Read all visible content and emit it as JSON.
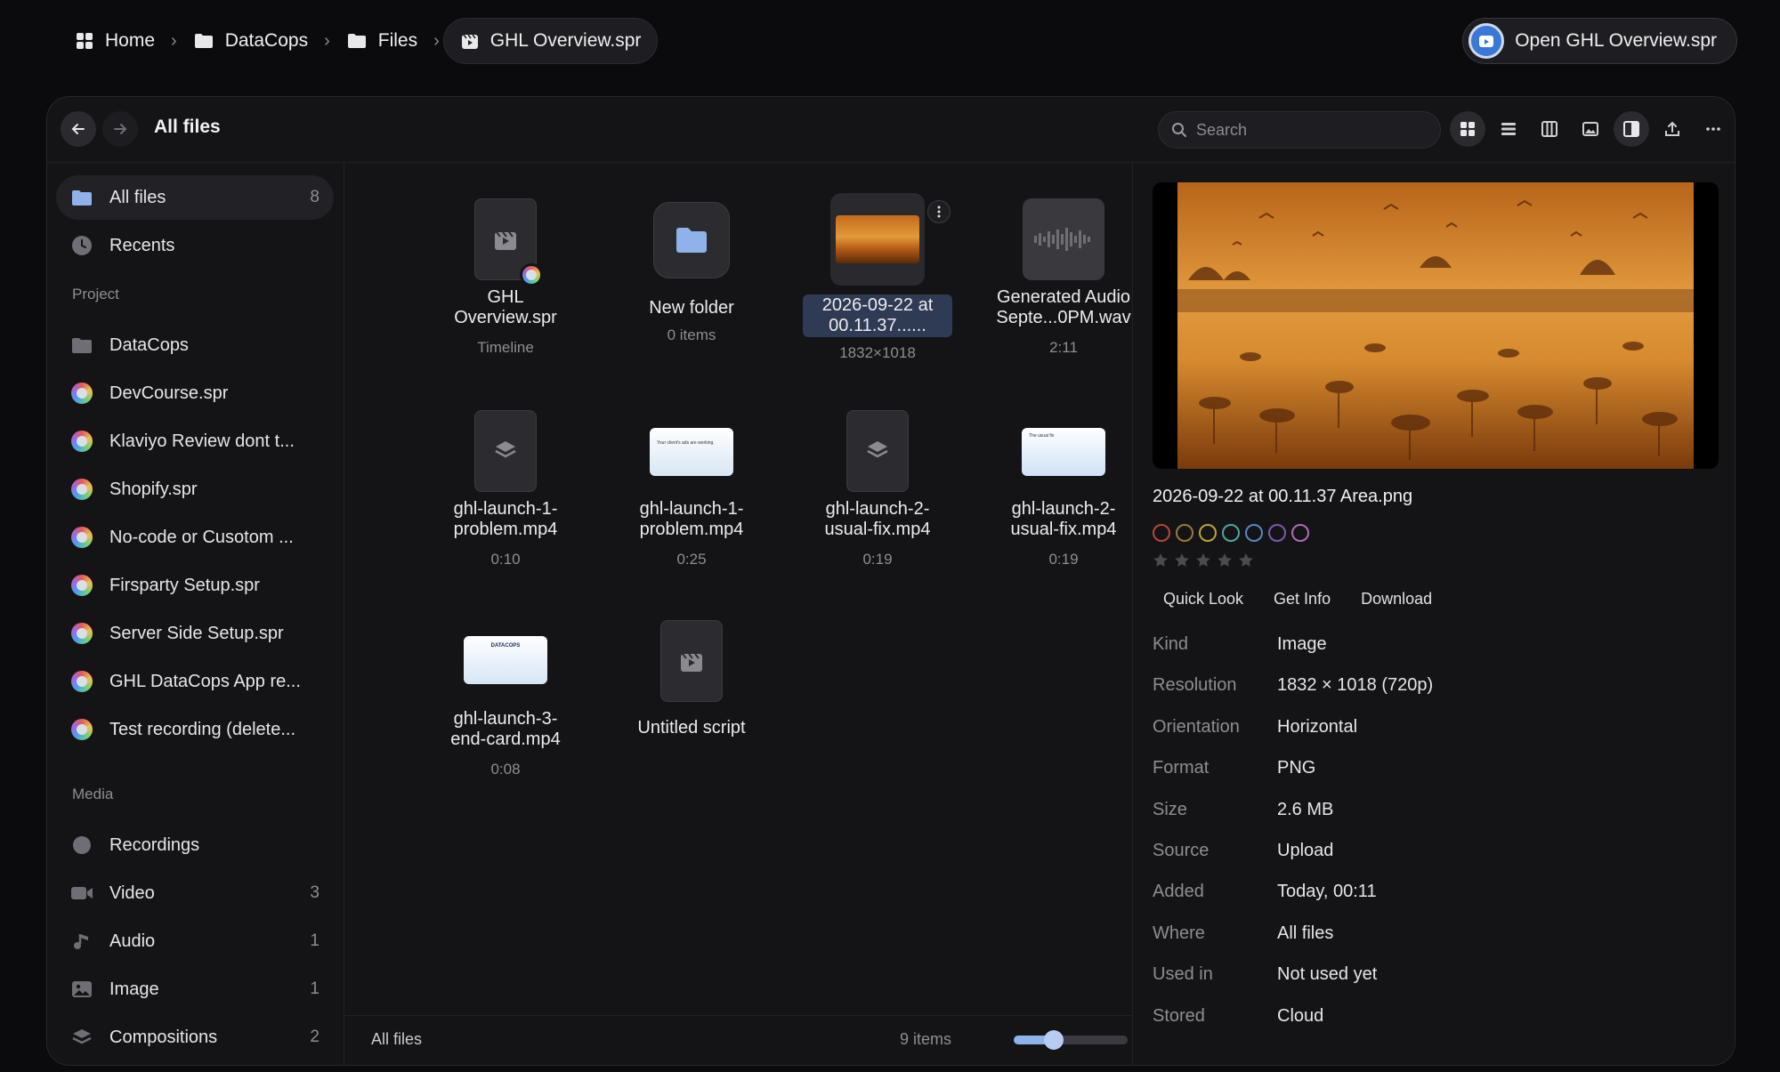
{
  "breadcrumb": {
    "items": [
      {
        "label": "Home",
        "icon": "grid-icon"
      },
      {
        "label": "DataCops",
        "icon": "folder-icon"
      },
      {
        "label": "Files",
        "icon": "folder-icon"
      },
      {
        "label": "GHL Overview.spr",
        "icon": "clapper-icon"
      }
    ]
  },
  "open_button": {
    "label": "Open GHL Overview.spr"
  },
  "toolbar": {
    "title": "All files",
    "search_placeholder": "Search",
    "view_icons": [
      "grid-view-icon",
      "list-view-icon",
      "columns-view-icon",
      "gallery-view-icon",
      "preview-pane-icon",
      "share-icon",
      "more-icon"
    ]
  },
  "sidebar": {
    "top": [
      {
        "label": "All files",
        "count": "8",
        "selected": true
      },
      {
        "label": "Recents",
        "count": ""
      }
    ],
    "project_heading": "Project",
    "project": [
      {
        "label": "DataCops",
        "kind": "folder"
      },
      {
        "label": "DevCourse.spr",
        "kind": "spr"
      },
      {
        "label": "Klaviyo Review dont t...",
        "kind": "spr"
      },
      {
        "label": "Shopify.spr",
        "kind": "spr"
      },
      {
        "label": "No-code or Cusotom ...",
        "kind": "spr"
      },
      {
        "label": "Firsparty Setup.spr",
        "kind": "spr"
      },
      {
        "label": "Server Side Setup.spr",
        "kind": "spr"
      },
      {
        "label": "GHL DataCops App re...",
        "kind": "spr"
      },
      {
        "label": "Test recording (delete...",
        "kind": "spr"
      }
    ],
    "media_heading": "Media",
    "media": [
      {
        "label": "Recordings",
        "count": "",
        "icon": "record-icon"
      },
      {
        "label": "Video",
        "count": "3",
        "icon": "video-icon"
      },
      {
        "label": "Audio",
        "count": "1",
        "icon": "music-note-icon"
      },
      {
        "label": "Image",
        "count": "1",
        "icon": "image-icon"
      },
      {
        "label": "Compositions",
        "count": "2",
        "icon": "layers-icon"
      }
    ]
  },
  "grid": {
    "tiles": [
      {
        "name_lines": [
          "GHL",
          "Overview.spr"
        ],
        "sub": "Timeline",
        "kind": "spr"
      },
      {
        "name_lines": [
          "New folder"
        ],
        "sub": "0 items",
        "kind": "folder"
      },
      {
        "name_lines": [
          "2026-09-22 at",
          "00.11.37......"
        ],
        "sub": "1832×1018",
        "kind": "image",
        "selected": true
      },
      {
        "name_lines": [
          "Generated Audio",
          "Septe...0PM.wav"
        ],
        "sub": "2:11",
        "kind": "audio"
      },
      {
        "name_lines": [
          "ghl-launch-1-",
          "problem.mp4"
        ],
        "sub": "0:10",
        "kind": "layers"
      },
      {
        "name_lines": [
          "ghl-launch-1-",
          "problem.mp4"
        ],
        "sub": "0:25",
        "kind": "video",
        "thumb_text": "Your client's ads are working."
      },
      {
        "name_lines": [
          "ghl-launch-2-",
          "usual-fix.mp4"
        ],
        "sub": "0:19",
        "kind": "layers"
      },
      {
        "name_lines": [
          "ghl-launch-2-",
          "usual-fix.mp4"
        ],
        "sub": "0:19",
        "kind": "video",
        "thumb_text": "The usual fix"
      },
      {
        "name_lines": [
          "ghl-launch-3-",
          "end-card.mp4"
        ],
        "sub": "0:08",
        "kind": "video",
        "thumb_text": "DATACOPS"
      },
      {
        "name_lines": [
          "Untitled script"
        ],
        "sub": "",
        "kind": "script"
      }
    ],
    "status_left": "All files",
    "status_count": "9 items",
    "zoom_level": 0.35
  },
  "preview": {
    "title": "2026-09-22 at 00.11.37 Area.png",
    "swatches": [
      "#b4473a",
      "#9a7a3a",
      "#b7a637",
      "#4aa8a0",
      "#5a86c8",
      "#7a5ab0",
      "#b06ab8"
    ],
    "rating": 0,
    "actions": [
      "Quick Look",
      "Get Info",
      "Download"
    ],
    "properties": [
      {
        "key": "Kind",
        "value": "Image"
      },
      {
        "key": "Resolution",
        "value": "1832 × 1018 (720p)"
      },
      {
        "key": "Orientation",
        "value": "Horizontal"
      },
      {
        "key": "Format",
        "value": "PNG"
      },
      {
        "key": "Size",
        "value": "2.6 MB"
      },
      {
        "key": "Source",
        "value": "Upload"
      },
      {
        "key": "Added",
        "value": "Today, 00:11"
      },
      {
        "key": "Where",
        "value": "All files"
      },
      {
        "key": "Used in",
        "value": "Not used yet"
      },
      {
        "key": "Stored",
        "value": "Cloud"
      }
    ]
  }
}
